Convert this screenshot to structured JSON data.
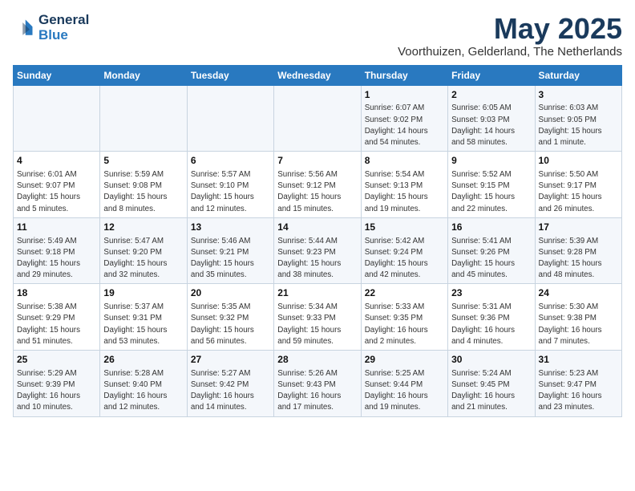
{
  "logo": {
    "line1": "General",
    "line2": "Blue"
  },
  "title": "May 2025",
  "location": "Voorthuizen, Gelderland, The Netherlands",
  "weekdays": [
    "Sunday",
    "Monday",
    "Tuesday",
    "Wednesday",
    "Thursday",
    "Friday",
    "Saturday"
  ],
  "weeks": [
    [
      {
        "day": "",
        "info": ""
      },
      {
        "day": "",
        "info": ""
      },
      {
        "day": "",
        "info": ""
      },
      {
        "day": "",
        "info": ""
      },
      {
        "day": "1",
        "info": "Sunrise: 6:07 AM\nSunset: 9:02 PM\nDaylight: 14 hours\nand 54 minutes."
      },
      {
        "day": "2",
        "info": "Sunrise: 6:05 AM\nSunset: 9:03 PM\nDaylight: 14 hours\nand 58 minutes."
      },
      {
        "day": "3",
        "info": "Sunrise: 6:03 AM\nSunset: 9:05 PM\nDaylight: 15 hours\nand 1 minute."
      }
    ],
    [
      {
        "day": "4",
        "info": "Sunrise: 6:01 AM\nSunset: 9:07 PM\nDaylight: 15 hours\nand 5 minutes."
      },
      {
        "day": "5",
        "info": "Sunrise: 5:59 AM\nSunset: 9:08 PM\nDaylight: 15 hours\nand 8 minutes."
      },
      {
        "day": "6",
        "info": "Sunrise: 5:57 AM\nSunset: 9:10 PM\nDaylight: 15 hours\nand 12 minutes."
      },
      {
        "day": "7",
        "info": "Sunrise: 5:56 AM\nSunset: 9:12 PM\nDaylight: 15 hours\nand 15 minutes."
      },
      {
        "day": "8",
        "info": "Sunrise: 5:54 AM\nSunset: 9:13 PM\nDaylight: 15 hours\nand 19 minutes."
      },
      {
        "day": "9",
        "info": "Sunrise: 5:52 AM\nSunset: 9:15 PM\nDaylight: 15 hours\nand 22 minutes."
      },
      {
        "day": "10",
        "info": "Sunrise: 5:50 AM\nSunset: 9:17 PM\nDaylight: 15 hours\nand 26 minutes."
      }
    ],
    [
      {
        "day": "11",
        "info": "Sunrise: 5:49 AM\nSunset: 9:18 PM\nDaylight: 15 hours\nand 29 minutes."
      },
      {
        "day": "12",
        "info": "Sunrise: 5:47 AM\nSunset: 9:20 PM\nDaylight: 15 hours\nand 32 minutes."
      },
      {
        "day": "13",
        "info": "Sunrise: 5:46 AM\nSunset: 9:21 PM\nDaylight: 15 hours\nand 35 minutes."
      },
      {
        "day": "14",
        "info": "Sunrise: 5:44 AM\nSunset: 9:23 PM\nDaylight: 15 hours\nand 38 minutes."
      },
      {
        "day": "15",
        "info": "Sunrise: 5:42 AM\nSunset: 9:24 PM\nDaylight: 15 hours\nand 42 minutes."
      },
      {
        "day": "16",
        "info": "Sunrise: 5:41 AM\nSunset: 9:26 PM\nDaylight: 15 hours\nand 45 minutes."
      },
      {
        "day": "17",
        "info": "Sunrise: 5:39 AM\nSunset: 9:28 PM\nDaylight: 15 hours\nand 48 minutes."
      }
    ],
    [
      {
        "day": "18",
        "info": "Sunrise: 5:38 AM\nSunset: 9:29 PM\nDaylight: 15 hours\nand 51 minutes."
      },
      {
        "day": "19",
        "info": "Sunrise: 5:37 AM\nSunset: 9:31 PM\nDaylight: 15 hours\nand 53 minutes."
      },
      {
        "day": "20",
        "info": "Sunrise: 5:35 AM\nSunset: 9:32 PM\nDaylight: 15 hours\nand 56 minutes."
      },
      {
        "day": "21",
        "info": "Sunrise: 5:34 AM\nSunset: 9:33 PM\nDaylight: 15 hours\nand 59 minutes."
      },
      {
        "day": "22",
        "info": "Sunrise: 5:33 AM\nSunset: 9:35 PM\nDaylight: 16 hours\nand 2 minutes."
      },
      {
        "day": "23",
        "info": "Sunrise: 5:31 AM\nSunset: 9:36 PM\nDaylight: 16 hours\nand 4 minutes."
      },
      {
        "day": "24",
        "info": "Sunrise: 5:30 AM\nSunset: 9:38 PM\nDaylight: 16 hours\nand 7 minutes."
      }
    ],
    [
      {
        "day": "25",
        "info": "Sunrise: 5:29 AM\nSunset: 9:39 PM\nDaylight: 16 hours\nand 10 minutes."
      },
      {
        "day": "26",
        "info": "Sunrise: 5:28 AM\nSunset: 9:40 PM\nDaylight: 16 hours\nand 12 minutes."
      },
      {
        "day": "27",
        "info": "Sunrise: 5:27 AM\nSunset: 9:42 PM\nDaylight: 16 hours\nand 14 minutes."
      },
      {
        "day": "28",
        "info": "Sunrise: 5:26 AM\nSunset: 9:43 PM\nDaylight: 16 hours\nand 17 minutes."
      },
      {
        "day": "29",
        "info": "Sunrise: 5:25 AM\nSunset: 9:44 PM\nDaylight: 16 hours\nand 19 minutes."
      },
      {
        "day": "30",
        "info": "Sunrise: 5:24 AM\nSunset: 9:45 PM\nDaylight: 16 hours\nand 21 minutes."
      },
      {
        "day": "31",
        "info": "Sunrise: 5:23 AM\nSunset: 9:47 PM\nDaylight: 16 hours\nand 23 minutes."
      }
    ]
  ]
}
